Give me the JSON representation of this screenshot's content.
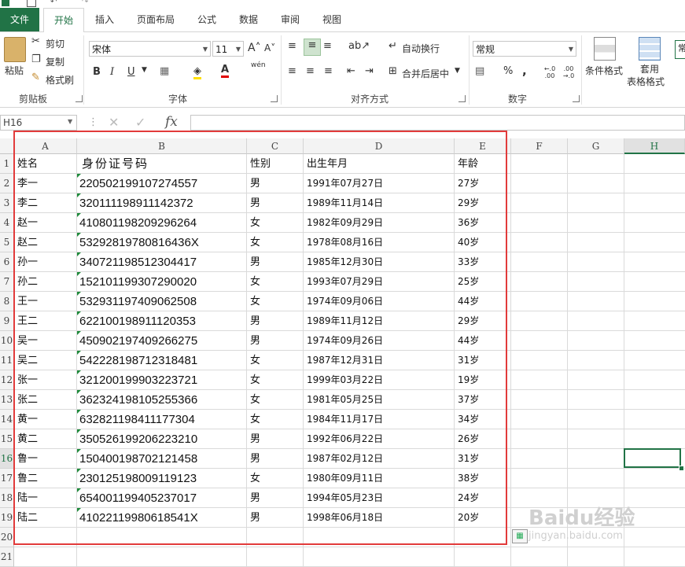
{
  "tabs": [
    "文件",
    "开始",
    "插入",
    "页面布局",
    "公式",
    "数据",
    "审阅",
    "视图"
  ],
  "ribbon": {
    "clipboard": {
      "paste": "粘贴",
      "cut": "剪切",
      "copy": "复制",
      "format_painter": "格式刷",
      "label": "剪贴板"
    },
    "font": {
      "name": "宋体",
      "size": "11",
      "bold": "B",
      "italic": "I",
      "underline": "U",
      "wen": "wén",
      "label": "字体"
    },
    "alignment": {
      "wrap": "自动换行",
      "merge": "合并后居中",
      "label": "对齐方式"
    },
    "number": {
      "format": "常规",
      "percent": "%",
      "comma": ",",
      "inc": "←.0 .00",
      "dec": ".00 →.0",
      "label": "数字"
    },
    "styles": {
      "conditional": "条件格式",
      "table_format_1": "套用",
      "table_format_2": "表格格式",
      "cell_style": "常"
    }
  },
  "formula_bar": {
    "name_box": "H16",
    "fx": "fx",
    "content": ""
  },
  "columns": [
    "A",
    "B",
    "C",
    "D",
    "E",
    "F",
    "G",
    "H"
  ],
  "selected_column": "H",
  "selected_row": 16,
  "rows": [
    "1",
    "2",
    "3",
    "4",
    "5",
    "6",
    "7",
    "8",
    "9",
    "10",
    "11",
    "12",
    "13",
    "14",
    "15",
    "16",
    "17",
    "18",
    "19",
    "20",
    "21"
  ],
  "headers": [
    "姓名",
    "身份证号码",
    "性别",
    "出生年月",
    "年龄"
  ],
  "records": [
    [
      "李一",
      "220502199107274557",
      "男",
      "1991年07月27日",
      "27岁"
    ],
    [
      "李二",
      "320111198911142372",
      "男",
      "1989年11月14日",
      "29岁"
    ],
    [
      "赵一",
      "410801198209296264",
      "女",
      "1982年09月29日",
      "36岁"
    ],
    [
      "赵二",
      "53292819780816436X",
      "女",
      "1978年08月16日",
      "40岁"
    ],
    [
      "孙一",
      "340721198512304417",
      "男",
      "1985年12月30日",
      "33岁"
    ],
    [
      "孙二",
      "152101199307290020",
      "女",
      "1993年07月29日",
      "25岁"
    ],
    [
      "王一",
      "532931197409062508",
      "女",
      "1974年09月06日",
      "44岁"
    ],
    [
      "王二",
      "622100198911120353",
      "男",
      "1989年11月12日",
      "29岁"
    ],
    [
      "吴一",
      "450902197409266275",
      "男",
      "1974年09月26日",
      "44岁"
    ],
    [
      "吴二",
      "542228198712318481",
      "女",
      "1987年12月31日",
      "31岁"
    ],
    [
      "张一",
      "321200199903223721",
      "女",
      "1999年03月22日",
      "19岁"
    ],
    [
      "张二",
      "362324198105255366",
      "女",
      "1981年05月25日",
      "37岁"
    ],
    [
      "黄一",
      "632821198411177304",
      "女",
      "1984年11月17日",
      "34岁"
    ],
    [
      "黄二",
      "350526199206223210",
      "男",
      "1992年06月22日",
      "26岁"
    ],
    [
      "鲁一",
      "150400198702121458",
      "男",
      "1987年02月12日",
      "31岁"
    ],
    [
      "鲁二",
      "230125198009119123",
      "女",
      "1980年09月11日",
      "38岁"
    ],
    [
      "陆一",
      "654001199405237017",
      "男",
      "1994年05月23日",
      "24岁"
    ],
    [
      "陆二",
      "41022119980618541X",
      "男",
      "1998年06月18日",
      "20岁"
    ]
  ],
  "watermark": {
    "main": "Baidu经验",
    "sub": "jingyan.baidu.com"
  },
  "colors": {
    "excel_green": "#217346",
    "highlight_red": "#e23b3b",
    "error_triangle": "#1e8a3b"
  }
}
